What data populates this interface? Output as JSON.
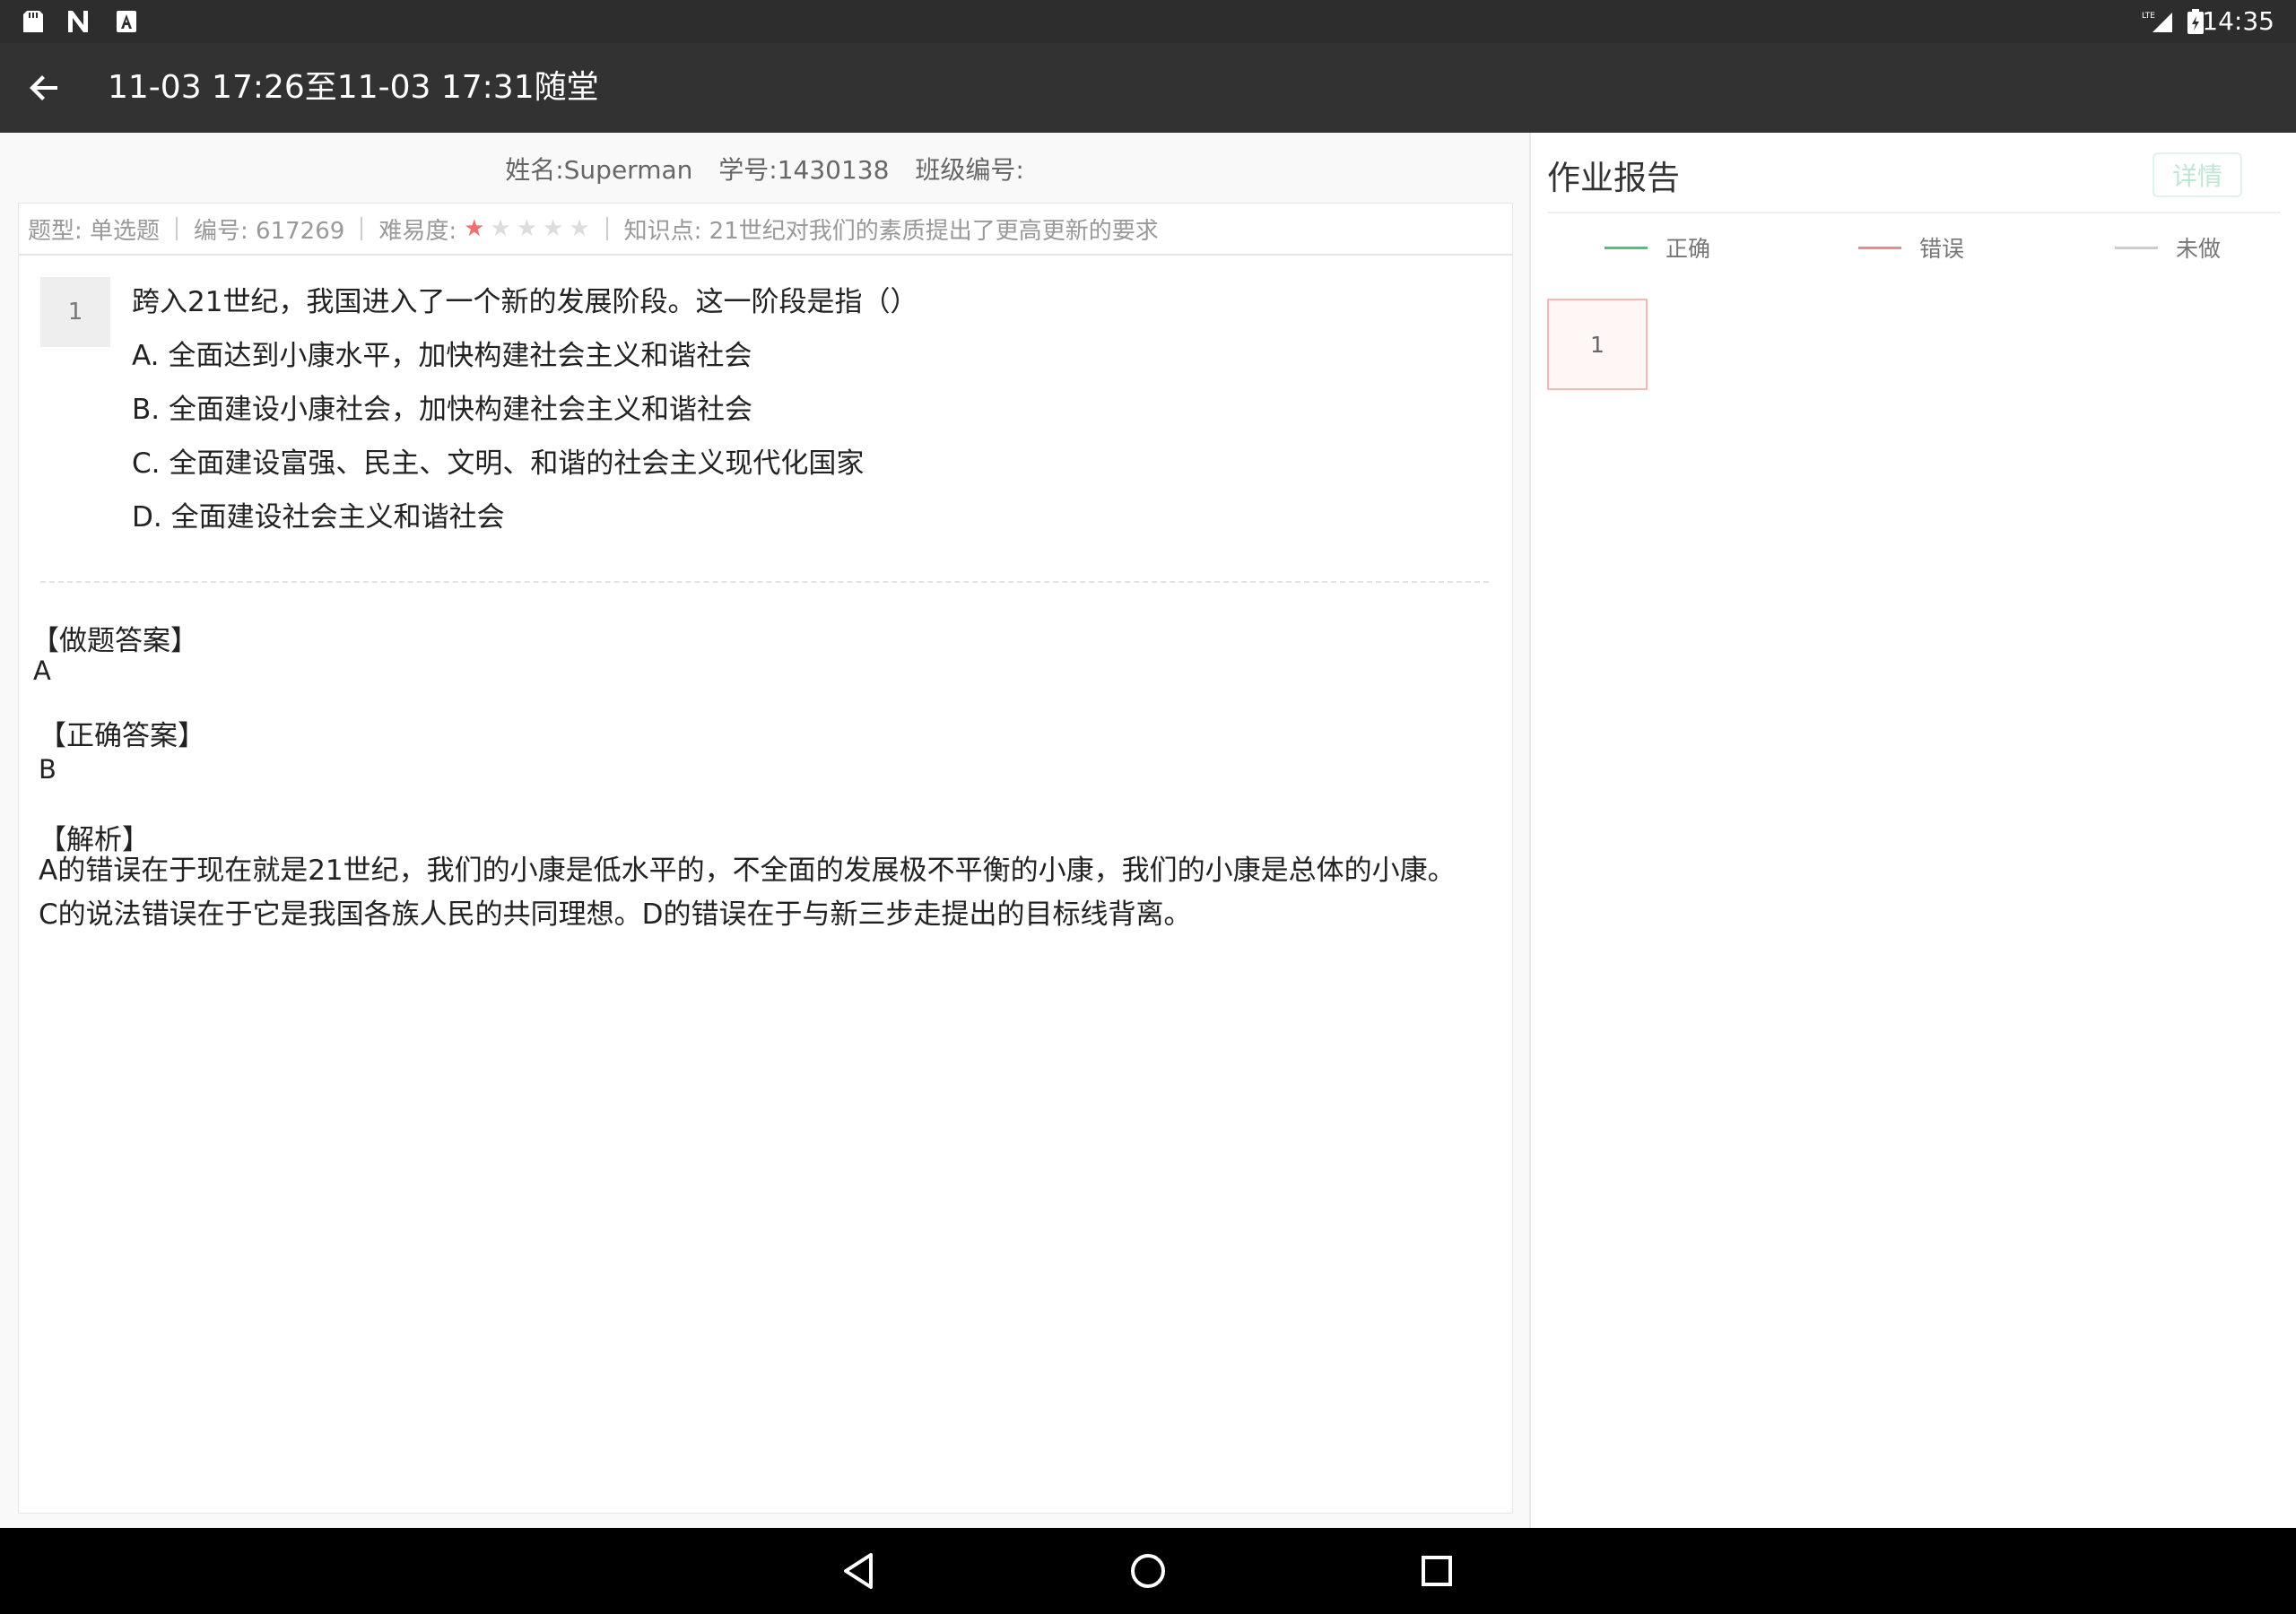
{
  "status_bar": {
    "time": "14:35",
    "icons": [
      "sd-card-icon",
      "n-icon",
      "a-icon",
      "lte-signal-icon",
      "battery-icon"
    ]
  },
  "app_bar": {
    "title": "11-03 17:26至11-03 17:31随堂",
    "back_icon": "arrow-left-icon"
  },
  "student": {
    "name": "姓名:Superman",
    "id": "学号:1430138",
    "class": "班级编号:"
  },
  "question_meta": {
    "type": "题型: 单选题",
    "code": "编号: 617269",
    "difficulty_label": "难易度:",
    "difficulty_stars": 1,
    "difficulty_max": 5,
    "knowledge": "知识点: 21世纪对我们的素质提出了更高更新的要求"
  },
  "question": {
    "number": "1",
    "text": "跨入21世纪，我国进入了一个新的发展阶段。这一阶段是指（）",
    "options": [
      "A. 全面达到小康水平，加快构建社会主义和谐社会",
      "B. 全面建设小康社会，加快构建社会主义和谐社会",
      "C. 全面建设富强、民主、文明、和谐的社会主义现代化国家",
      "D. 全面建设社会主义和谐社会"
    ]
  },
  "answers": {
    "my_answer_title": "【做题答案】",
    "my_answer": "A",
    "correct_title": "【正确答案】",
    "correct": "B",
    "analysis_title": "【解析】",
    "analysis": "A的错误在于现在就是21世纪，我们的小康是低水平的，不全面的发展极不平衡的小康，我们的小康是总体的小康。C的说法错误在于它是我国各族人民的共同理想。D的错误在于与新三步走提出的目标线背离。"
  },
  "report": {
    "title": "作业报告",
    "detail_button": "详情",
    "legend": [
      {
        "label": "正确",
        "color": "#4cc18a"
      },
      {
        "label": "错误",
        "color": "#f08a8a"
      },
      {
        "label": "未做",
        "color": "#cccccc"
      }
    ],
    "questions": [
      {
        "number": "1",
        "status": "wrong"
      }
    ]
  },
  "colors": {
    "app_bar": "#323232",
    "status_bar": "#2d2d2d",
    "star_on": "#f26f6f",
    "wrong_box": "#f3b8b8"
  }
}
